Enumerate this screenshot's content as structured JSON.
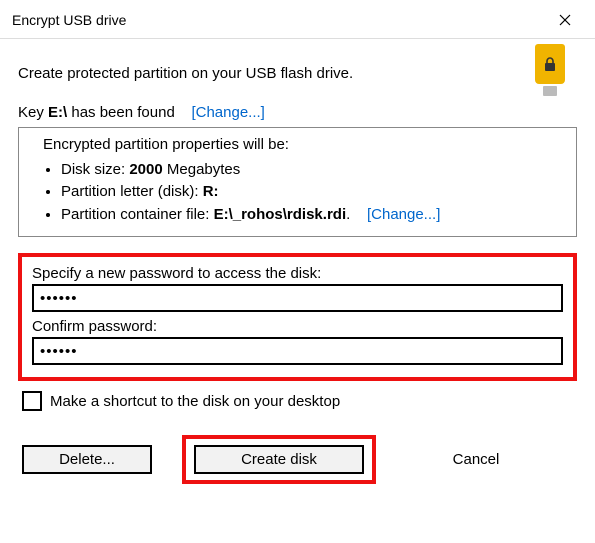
{
  "window": {
    "title": "Encrypt USB drive"
  },
  "subtitle": "Create protected partition on your USB flash drive.",
  "key_line": {
    "prefix": "Key ",
    "drive": "E:\\",
    "suffix": " has been found",
    "change_label": "Change..."
  },
  "props": {
    "heading": "Encrypted partition properties will be:",
    "disk_size_label": "Disk size: ",
    "disk_size_value": "2000",
    "disk_size_unit": " Megabytes",
    "letter_label": "Partition letter (disk): ",
    "letter_value": "R:",
    "container_label": "Partition container file: ",
    "container_value": "E:\\_rohos\\rdisk.rdi",
    "container_dot": ".",
    "change_label": "Change..."
  },
  "passwords": {
    "new_label": "Specify a new password to access the disk:",
    "new_value": "......",
    "confirm_label": "Confirm password:",
    "confirm_value": "......"
  },
  "shortcut": {
    "label": "Make a shortcut to the disk on your desktop",
    "checked": false
  },
  "buttons": {
    "delete": "Delete...",
    "create": "Create disk",
    "cancel": "Cancel"
  },
  "icons": {
    "close": "close-icon",
    "usb": "usb-lock-icon"
  }
}
